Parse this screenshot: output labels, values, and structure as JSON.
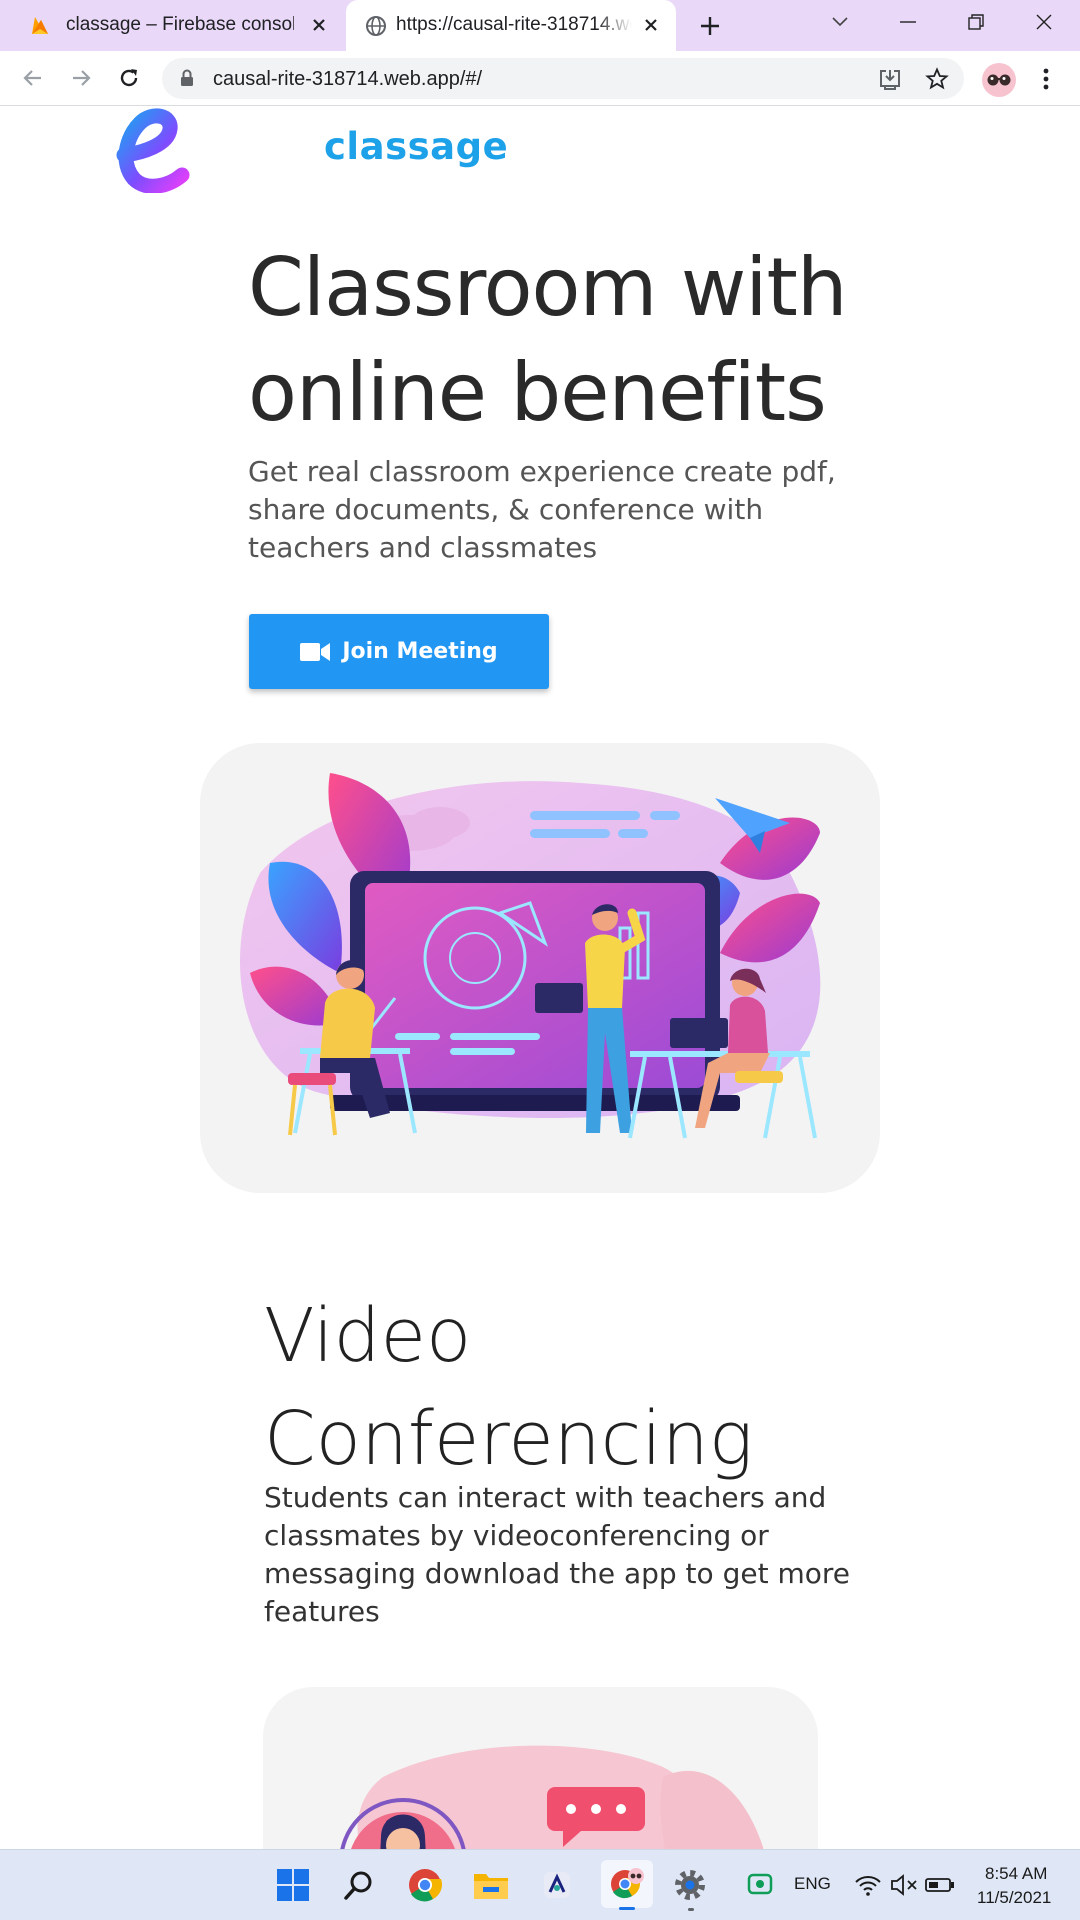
{
  "browser": {
    "tabs": [
      {
        "title": "classage – Firebase console",
        "icon": "firebase-icon",
        "active": false
      },
      {
        "title": "https://causal-rite-318714.web.app/#/",
        "icon": "globe-icon",
        "active": true
      }
    ],
    "address_bar": {
      "url": "causal-rite-318714.web.app/#/"
    },
    "colors": {
      "titlebar": "#e9d8f7",
      "omnibox": "#f1f3f4"
    }
  },
  "site": {
    "brand": {
      "logo_letter": "e",
      "name": "classage"
    },
    "hero": {
      "title": "Classroom with online benefits",
      "subtitle": "Get real classroom experience create pdf, share documents, & conference with teachers and classmates",
      "cta_label": "Join Meeting",
      "cta_icon": "video-camera-icon"
    },
    "features": [
      {
        "title": "Video Conferencing",
        "body": "Students can interact with teachers and classmates by videoconferencing or messaging download the app to get more features"
      }
    ],
    "colors": {
      "accent": "#2196f3",
      "brand": "#1da1e8"
    }
  },
  "taskbar": {
    "language": "ENG",
    "time": "8:54 AM",
    "date": "11/5/2021",
    "icons": [
      "windows-start-icon",
      "search-icon",
      "chrome-icon",
      "file-explorer-icon",
      "app-icon",
      "chrome-profile-icon",
      "settings-icon"
    ],
    "tray_icons": [
      "network-app-icon",
      "wifi-icon",
      "volume-muted-icon",
      "battery-icon"
    ]
  }
}
